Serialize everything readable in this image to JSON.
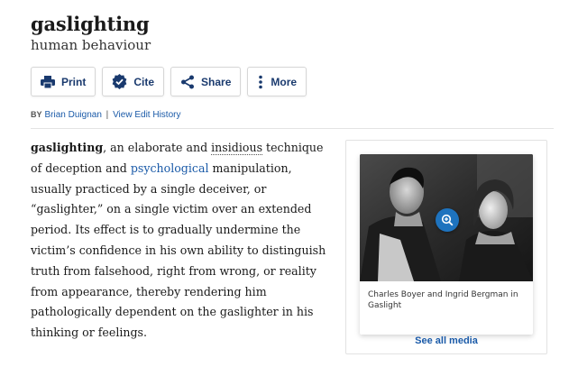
{
  "header": {
    "title": "gaslighting",
    "subtitle": "human behaviour"
  },
  "actions": {
    "print_label": "Print",
    "cite_label": "Cite",
    "share_label": "Share",
    "more_label": "More"
  },
  "byline": {
    "by": "BY",
    "author": "Brian Duignan",
    "separator": "|",
    "history": "View Edit History"
  },
  "article": {
    "term": "gaslighting",
    "part1": ", an elaborate and ",
    "insidious": "insidious",
    "part2": " technique of deception and ",
    "psychological": "psychological",
    "part3": " manipulation, usually practiced by a single deceiver, or “gaslighter,” on a single victim over an extended period. Its effect is to gradually undermine the victim’s confidence in his own ability to distinguish truth from falsehood, right from wrong, or reality from appearance, thereby rendering him pathologically dependent on the gaslighter in his thinking or feelings."
  },
  "media": {
    "caption": "Charles Boyer and Ingrid Bergman in Gaslight",
    "see_all": "See all media",
    "zoom_icon": "zoom-in-icon"
  },
  "colors": {
    "link": "#1a5aa8",
    "button_text": "#1a3a6e",
    "zoom": "#1e73be"
  }
}
